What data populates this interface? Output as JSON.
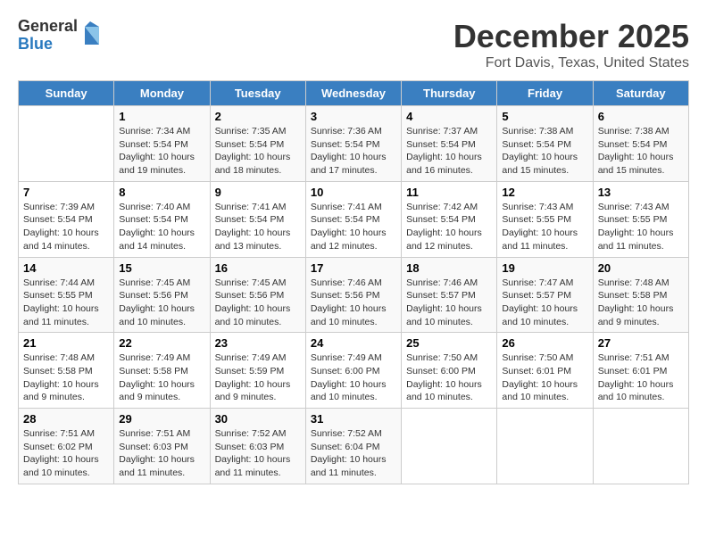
{
  "header": {
    "logo_general": "General",
    "logo_blue": "Blue",
    "title": "December 2025",
    "subtitle": "Fort Davis, Texas, United States"
  },
  "columns": [
    "Sunday",
    "Monday",
    "Tuesday",
    "Wednesday",
    "Thursday",
    "Friday",
    "Saturday"
  ],
  "weeks": [
    [
      {
        "num": "",
        "info": ""
      },
      {
        "num": "1",
        "info": "Sunrise: 7:34 AM\nSunset: 5:54 PM\nDaylight: 10 hours\nand 19 minutes."
      },
      {
        "num": "2",
        "info": "Sunrise: 7:35 AM\nSunset: 5:54 PM\nDaylight: 10 hours\nand 18 minutes."
      },
      {
        "num": "3",
        "info": "Sunrise: 7:36 AM\nSunset: 5:54 PM\nDaylight: 10 hours\nand 17 minutes."
      },
      {
        "num": "4",
        "info": "Sunrise: 7:37 AM\nSunset: 5:54 PM\nDaylight: 10 hours\nand 16 minutes."
      },
      {
        "num": "5",
        "info": "Sunrise: 7:38 AM\nSunset: 5:54 PM\nDaylight: 10 hours\nand 15 minutes."
      },
      {
        "num": "6",
        "info": "Sunrise: 7:38 AM\nSunset: 5:54 PM\nDaylight: 10 hours\nand 15 minutes."
      }
    ],
    [
      {
        "num": "7",
        "info": "Sunrise: 7:39 AM\nSunset: 5:54 PM\nDaylight: 10 hours\nand 14 minutes."
      },
      {
        "num": "8",
        "info": "Sunrise: 7:40 AM\nSunset: 5:54 PM\nDaylight: 10 hours\nand 14 minutes."
      },
      {
        "num": "9",
        "info": "Sunrise: 7:41 AM\nSunset: 5:54 PM\nDaylight: 10 hours\nand 13 minutes."
      },
      {
        "num": "10",
        "info": "Sunrise: 7:41 AM\nSunset: 5:54 PM\nDaylight: 10 hours\nand 12 minutes."
      },
      {
        "num": "11",
        "info": "Sunrise: 7:42 AM\nSunset: 5:54 PM\nDaylight: 10 hours\nand 12 minutes."
      },
      {
        "num": "12",
        "info": "Sunrise: 7:43 AM\nSunset: 5:55 PM\nDaylight: 10 hours\nand 11 minutes."
      },
      {
        "num": "13",
        "info": "Sunrise: 7:43 AM\nSunset: 5:55 PM\nDaylight: 10 hours\nand 11 minutes."
      }
    ],
    [
      {
        "num": "14",
        "info": "Sunrise: 7:44 AM\nSunset: 5:55 PM\nDaylight: 10 hours\nand 11 minutes."
      },
      {
        "num": "15",
        "info": "Sunrise: 7:45 AM\nSunset: 5:56 PM\nDaylight: 10 hours\nand 10 minutes."
      },
      {
        "num": "16",
        "info": "Sunrise: 7:45 AM\nSunset: 5:56 PM\nDaylight: 10 hours\nand 10 minutes."
      },
      {
        "num": "17",
        "info": "Sunrise: 7:46 AM\nSunset: 5:56 PM\nDaylight: 10 hours\nand 10 minutes."
      },
      {
        "num": "18",
        "info": "Sunrise: 7:46 AM\nSunset: 5:57 PM\nDaylight: 10 hours\nand 10 minutes."
      },
      {
        "num": "19",
        "info": "Sunrise: 7:47 AM\nSunset: 5:57 PM\nDaylight: 10 hours\nand 10 minutes."
      },
      {
        "num": "20",
        "info": "Sunrise: 7:48 AM\nSunset: 5:58 PM\nDaylight: 10 hours\nand 9 minutes."
      }
    ],
    [
      {
        "num": "21",
        "info": "Sunrise: 7:48 AM\nSunset: 5:58 PM\nDaylight: 10 hours\nand 9 minutes."
      },
      {
        "num": "22",
        "info": "Sunrise: 7:49 AM\nSunset: 5:58 PM\nDaylight: 10 hours\nand 9 minutes."
      },
      {
        "num": "23",
        "info": "Sunrise: 7:49 AM\nSunset: 5:59 PM\nDaylight: 10 hours\nand 9 minutes."
      },
      {
        "num": "24",
        "info": "Sunrise: 7:49 AM\nSunset: 6:00 PM\nDaylight: 10 hours\nand 10 minutes."
      },
      {
        "num": "25",
        "info": "Sunrise: 7:50 AM\nSunset: 6:00 PM\nDaylight: 10 hours\nand 10 minutes."
      },
      {
        "num": "26",
        "info": "Sunrise: 7:50 AM\nSunset: 6:01 PM\nDaylight: 10 hours\nand 10 minutes."
      },
      {
        "num": "27",
        "info": "Sunrise: 7:51 AM\nSunset: 6:01 PM\nDaylight: 10 hours\nand 10 minutes."
      }
    ],
    [
      {
        "num": "28",
        "info": "Sunrise: 7:51 AM\nSunset: 6:02 PM\nDaylight: 10 hours\nand 10 minutes."
      },
      {
        "num": "29",
        "info": "Sunrise: 7:51 AM\nSunset: 6:03 PM\nDaylight: 10 hours\nand 11 minutes."
      },
      {
        "num": "30",
        "info": "Sunrise: 7:52 AM\nSunset: 6:03 PM\nDaylight: 10 hours\nand 11 minutes."
      },
      {
        "num": "31",
        "info": "Sunrise: 7:52 AM\nSunset: 6:04 PM\nDaylight: 10 hours\nand 11 minutes."
      },
      {
        "num": "",
        "info": ""
      },
      {
        "num": "",
        "info": ""
      },
      {
        "num": "",
        "info": ""
      }
    ]
  ]
}
